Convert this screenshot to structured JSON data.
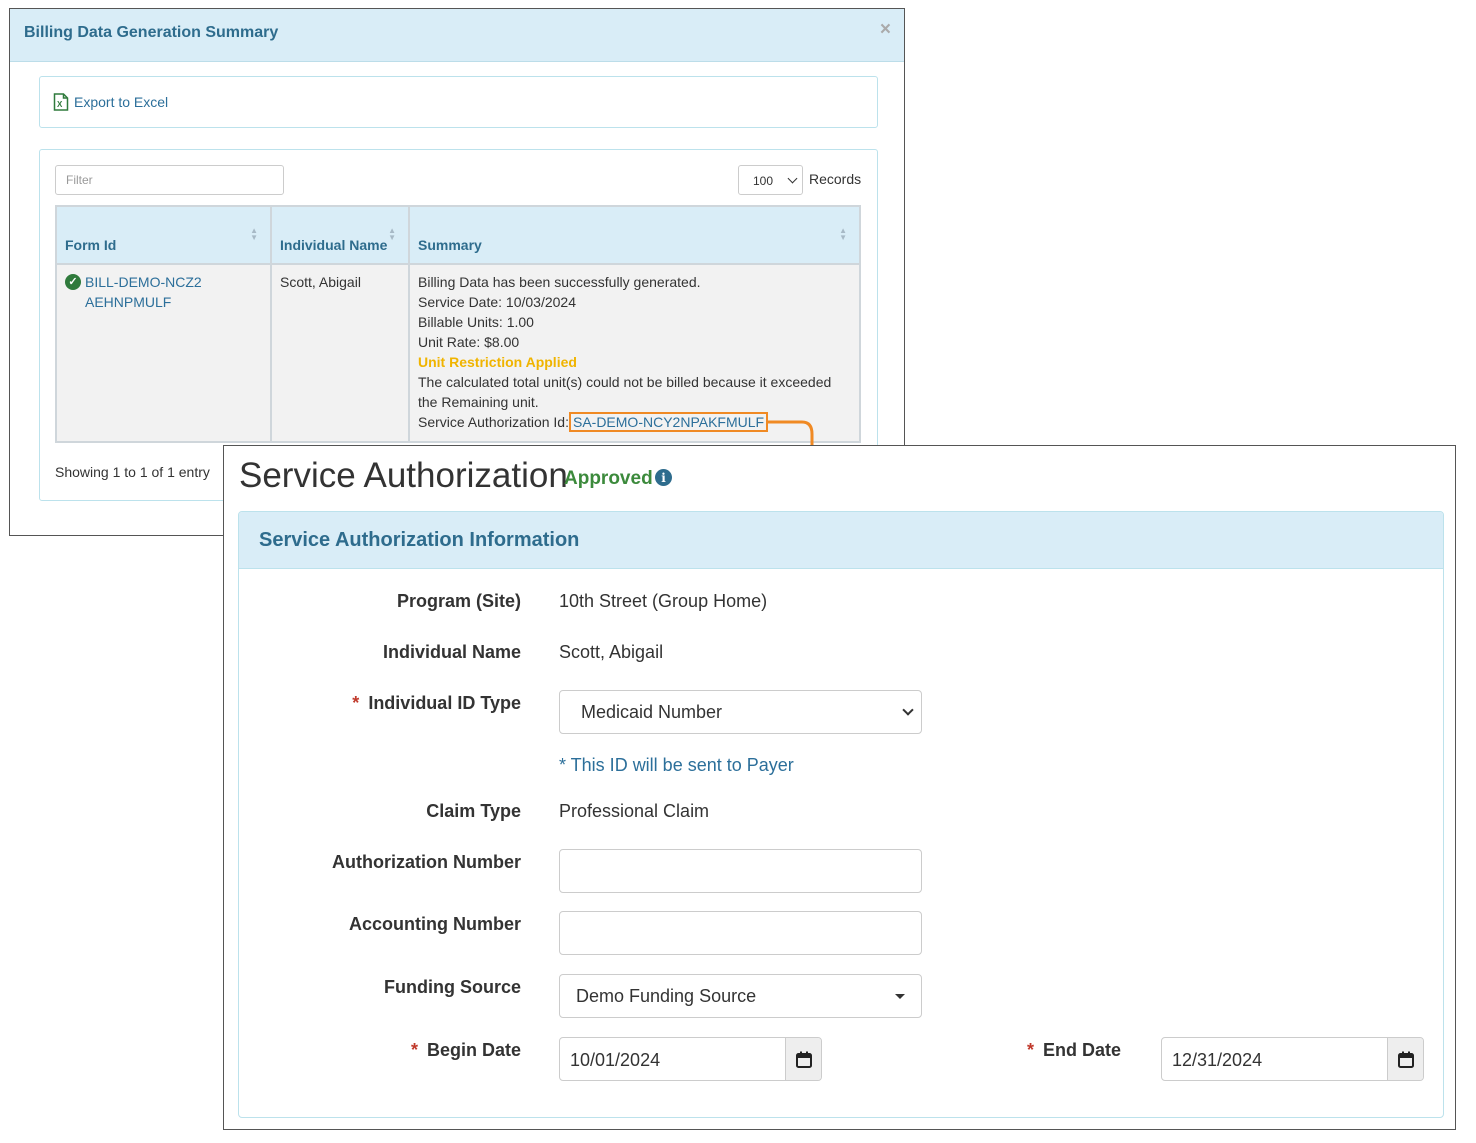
{
  "billing": {
    "title": "Billing Data Generation Summary",
    "close_label": "×",
    "export_label": "Export to Excel",
    "filter_placeholder": "Filter",
    "records_selected": "100",
    "records_label": "Records",
    "columns": [
      "Form Id",
      "Individual Name",
      "Summary"
    ],
    "row": {
      "form_id": "BILL-DEMO-NCZ2AEHNPMULF",
      "individual_name": "Scott, Abigail",
      "summary_lines": [
        "Billing Data has been successfully generated.",
        "Service Date: 10/03/2024",
        "Billable Units: 1.00",
        "Unit Rate: $8.00"
      ],
      "restriction": "Unit Restriction Applied",
      "restriction_note": "The calculated total unit(s) could not be billed because it exceeded the Remaining unit.",
      "sa_label": "Service Authorization Id:",
      "sa_id": "SA-DEMO-NCY2NPAKFMULF"
    },
    "showing": "Showing 1 to 1 of 1 entry"
  },
  "sa": {
    "title": "Service Authorization",
    "status": "Approved",
    "panel_title": "Service Authorization Information",
    "fields": {
      "program_label": "Program (Site)",
      "program_value": "10th Street (Group Home)",
      "name_label": "Individual Name",
      "name_value": "Scott, Abigail",
      "id_type_label": "Individual ID Type",
      "id_type_value": "Medicaid Number",
      "id_hint": "* This ID will be sent to Payer",
      "claim_label": "Claim Type",
      "claim_value": "Professional Claim",
      "auth_label": "Authorization Number",
      "auth_value": "",
      "acct_label": "Accounting Number",
      "acct_value": "",
      "funding_label": "Funding Source",
      "funding_value": "Demo Funding Source",
      "begin_label": "Begin Date",
      "begin_value": "10/01/2024",
      "end_label": "End Date",
      "end_value": "12/31/2024",
      "required_mark": "*"
    }
  },
  "colors": {
    "header_bg": "#d9edf7",
    "header_text": "#2e6c8d",
    "link": "#2c6f9a",
    "approved": "#3c8a3c",
    "warning": "#f0b400",
    "highlight": "#f08a24",
    "required": "#c0392b"
  }
}
